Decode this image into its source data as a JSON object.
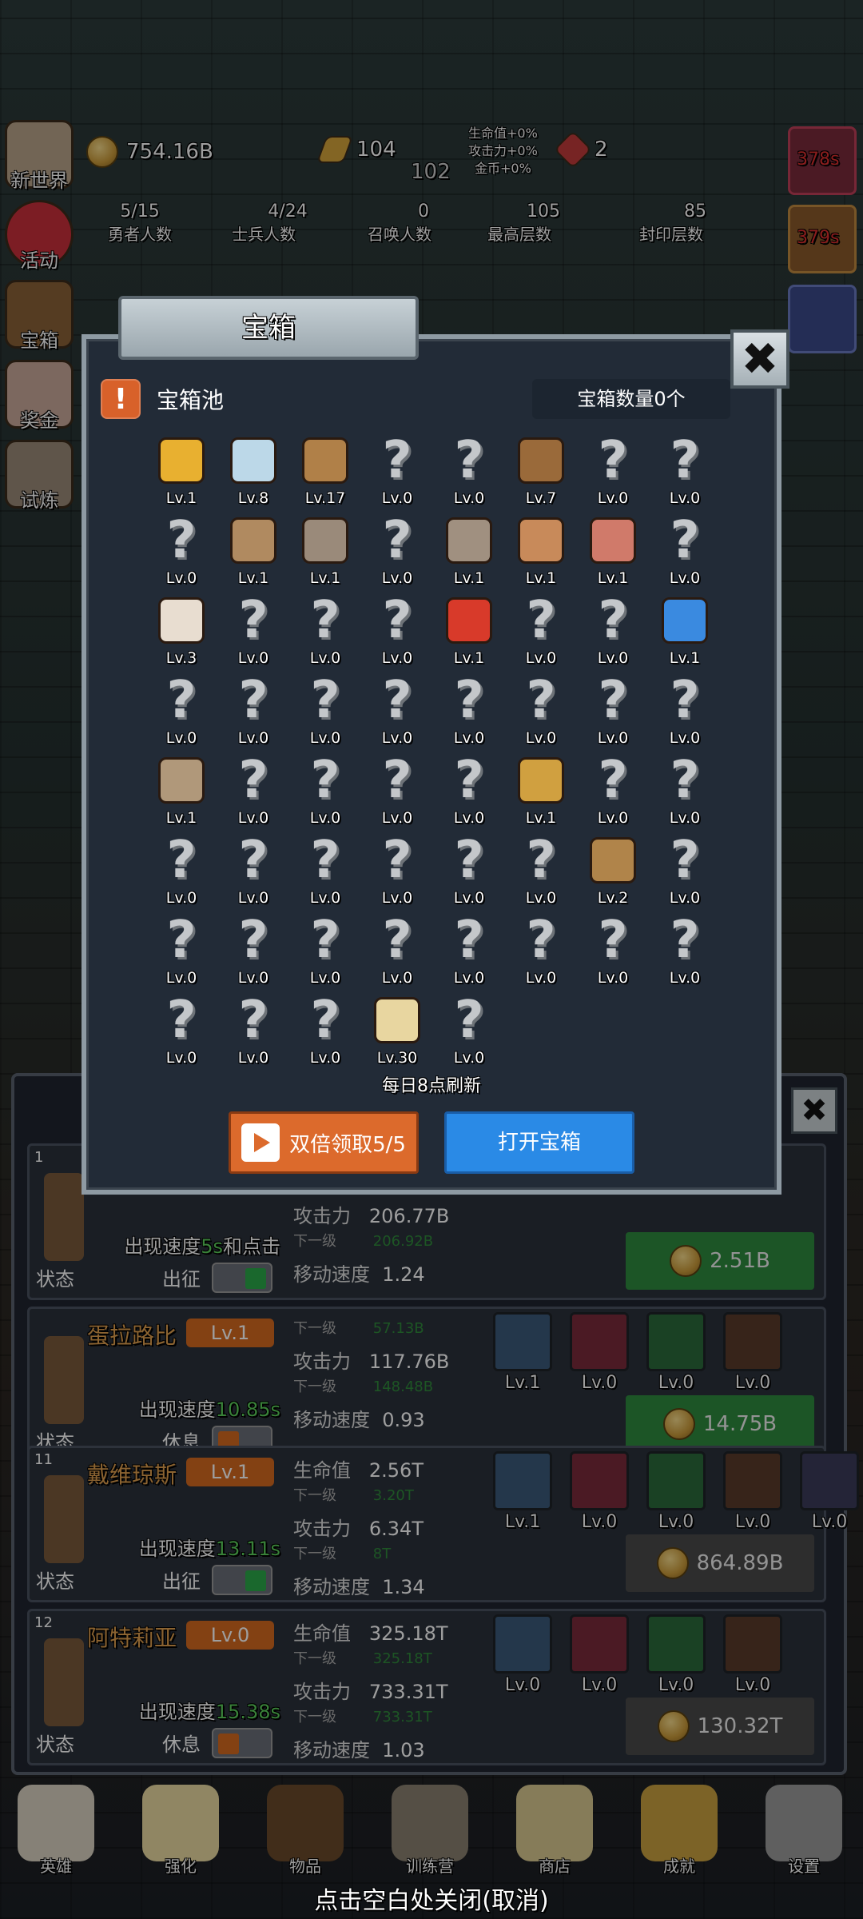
{
  "top": {
    "gold": "754.16B",
    "bars": "104",
    "bars_sub": "102",
    "bonus": [
      "生命值+0%",
      "攻击力+0%",
      "金币+0%"
    ],
    "gems": "2",
    "timer1": "378s",
    "timer2": "379s"
  },
  "counts": [
    {
      "value": "5/15",
      "label": "勇者人数"
    },
    {
      "value": "4/24",
      "label": "士兵人数"
    },
    {
      "value": "0",
      "label": "召唤人数"
    },
    {
      "value": "105",
      "label": "最高层数"
    },
    {
      "value": "85",
      "label": "封印层数"
    }
  ],
  "side": [
    "新世界",
    "活动",
    "宝箱",
    "奖金",
    "试炼"
  ],
  "modal": {
    "title": "宝箱",
    "pool_title": "宝箱池",
    "count_label": "宝箱数量0个",
    "refresh": "每日8点刷新",
    "double_btn": "双倍领取5/5",
    "open_btn": "打开宝箱",
    "close_glyph": "✖",
    "alert_glyph": "!",
    "items": [
      {
        "icon": "crown",
        "lv": "Lv.1"
      },
      {
        "icon": "diamond",
        "lv": "Lv.8"
      },
      {
        "icon": "sword",
        "lv": "Lv.17"
      },
      {
        "icon": "unknown",
        "lv": "Lv.0"
      },
      {
        "icon": "unknown",
        "lv": "Lv.0"
      },
      {
        "icon": "backpack",
        "lv": "Lv.7"
      },
      {
        "icon": "unknown",
        "lv": "Lv.0"
      },
      {
        "icon": "unknown",
        "lv": "Lv.0"
      },
      {
        "icon": "unknown",
        "lv": "Lv.0"
      },
      {
        "icon": "dagger",
        "lv": "Lv.1"
      },
      {
        "icon": "helmet",
        "lv": "Lv.1"
      },
      {
        "icon": "unknown",
        "lv": "Lv.0"
      },
      {
        "icon": "knight-helmet",
        "lv": "Lv.1"
      },
      {
        "icon": "drumstick",
        "lv": "Lv.1"
      },
      {
        "icon": "steak",
        "lv": "Lv.1"
      },
      {
        "icon": "unknown",
        "lv": "Lv.0"
      },
      {
        "icon": "rice-bowl",
        "lv": "Lv.3"
      },
      {
        "icon": "unknown",
        "lv": "Lv.0"
      },
      {
        "icon": "unknown",
        "lv": "Lv.0"
      },
      {
        "icon": "unknown",
        "lv": "Lv.0"
      },
      {
        "icon": "red-potion",
        "lv": "Lv.1"
      },
      {
        "icon": "unknown",
        "lv": "Lv.0"
      },
      {
        "icon": "unknown",
        "lv": "Lv.0"
      },
      {
        "icon": "blue-potion",
        "lv": "Lv.1"
      },
      {
        "icon": "unknown",
        "lv": "Lv.0"
      },
      {
        "icon": "unknown",
        "lv": "Lv.0"
      },
      {
        "icon": "unknown",
        "lv": "Lv.0"
      },
      {
        "icon": "unknown",
        "lv": "Lv.0"
      },
      {
        "icon": "unknown",
        "lv": "Lv.0"
      },
      {
        "icon": "unknown",
        "lv": "Lv.0"
      },
      {
        "icon": "unknown",
        "lv": "Lv.0"
      },
      {
        "icon": "unknown",
        "lv": "Lv.0"
      },
      {
        "icon": "boot",
        "lv": "Lv.1"
      },
      {
        "icon": "unknown",
        "lv": "Lv.0"
      },
      {
        "icon": "unknown",
        "lv": "Lv.0"
      },
      {
        "icon": "unknown",
        "lv": "Lv.0"
      },
      {
        "icon": "unknown",
        "lv": "Lv.0"
      },
      {
        "icon": "torch",
        "lv": "Lv.1"
      },
      {
        "icon": "unknown",
        "lv": "Lv.0"
      },
      {
        "icon": "unknown",
        "lv": "Lv.0"
      },
      {
        "icon": "unknown",
        "lv": "Lv.0"
      },
      {
        "icon": "unknown",
        "lv": "Lv.0"
      },
      {
        "icon": "unknown",
        "lv": "Lv.0"
      },
      {
        "icon": "unknown",
        "lv": "Lv.0"
      },
      {
        "icon": "unknown",
        "lv": "Lv.0"
      },
      {
        "icon": "unknown",
        "lv": "Lv.0"
      },
      {
        "icon": "satchel",
        "lv": "Lv.2"
      },
      {
        "icon": "unknown",
        "lv": "Lv.0"
      },
      {
        "icon": "unknown",
        "lv": "Lv.0"
      },
      {
        "icon": "unknown",
        "lv": "Lv.0"
      },
      {
        "icon": "unknown",
        "lv": "Lv.0"
      },
      {
        "icon": "unknown",
        "lv": "Lv.0"
      },
      {
        "icon": "unknown",
        "lv": "Lv.0"
      },
      {
        "icon": "unknown",
        "lv": "Lv.0"
      },
      {
        "icon": "unknown",
        "lv": "Lv.0"
      },
      {
        "icon": "unknown",
        "lv": "Lv.0"
      },
      {
        "icon": "unknown",
        "lv": "Lv.0"
      },
      {
        "icon": "unknown",
        "lv": "Lv.0"
      },
      {
        "icon": "unknown",
        "lv": "Lv.0"
      },
      {
        "icon": "beer-mug",
        "lv": "Lv.30"
      },
      {
        "icon": "unknown",
        "lv": "Lv.0"
      }
    ]
  },
  "heroes": [
    {
      "num": "1",
      "name": "",
      "lvl": "",
      "speed_pre": "出现速度",
      "speed": "5s",
      "speed_post": "和点击",
      "state": "状态",
      "action": "出征",
      "on": true,
      "hp": "",
      "hp_next": "",
      "atk": "206.77B",
      "atk_next": "206.92B",
      "move": "1.24",
      "cost": "2.51B",
      "skills": []
    },
    {
      "num": "",
      "name": "蛋拉路比",
      "lvl": "Lv.1",
      "speed_pre": "出现速度",
      "speed": "10.85s",
      "speed_post": "",
      "state": "状态",
      "action": "休息",
      "on": false,
      "hp": "",
      "hp_next": "57.13B",
      "atk": "117.76B",
      "atk_next": "148.48B",
      "move": "0.93",
      "cost": "14.75B",
      "skills": [
        "Lv.1",
        "Lv.0",
        "Lv.0",
        "Lv.0"
      ]
    },
    {
      "num": "11",
      "name": "戴维琼斯",
      "lvl": "Lv.1",
      "speed_pre": "出现速度",
      "speed": "13.11s",
      "speed_post": "",
      "state": "状态",
      "action": "出征",
      "on": true,
      "hp": "2.56T",
      "hp_next": "3.20T",
      "atk": "6.34T",
      "atk_next": "8T",
      "move": "1.34",
      "cost": "864.89B",
      "skills": [
        "Lv.1",
        "Lv.0",
        "Lv.0",
        "Lv.0",
        "Lv.0"
      ]
    },
    {
      "num": "12",
      "name": "阿特莉亚",
      "lvl": "Lv.0",
      "speed_pre": "出现速度",
      "speed": "15.38s",
      "speed_post": "",
      "state": "状态",
      "action": "休息",
      "on": false,
      "hp": "325.18T",
      "hp_next": "325.18T",
      "atk": "733.31T",
      "atk_next": "733.31T",
      "move": "1.03",
      "cost": "130.32T",
      "skills": [
        "Lv.0",
        "Lv.0",
        "Lv.0",
        "Lv.0"
      ]
    }
  ],
  "labels": {
    "hp": "生命值",
    "atk": "攻击力",
    "next": "下一级",
    "move": "移动速度"
  },
  "nav": [
    {
      "label": "英雄",
      "icon": "skull-icon"
    },
    {
      "label": "强化",
      "icon": "candle-icon"
    },
    {
      "label": "物品",
      "icon": "book-icon"
    },
    {
      "label": "训练营",
      "icon": "lantern-icon"
    },
    {
      "label": "商店",
      "icon": "beer-icon"
    },
    {
      "label": "成就",
      "icon": "key-icon"
    },
    {
      "label": "设置",
      "icon": "gear-icon"
    }
  ],
  "hint": "点击空白处关闭(取消)"
}
